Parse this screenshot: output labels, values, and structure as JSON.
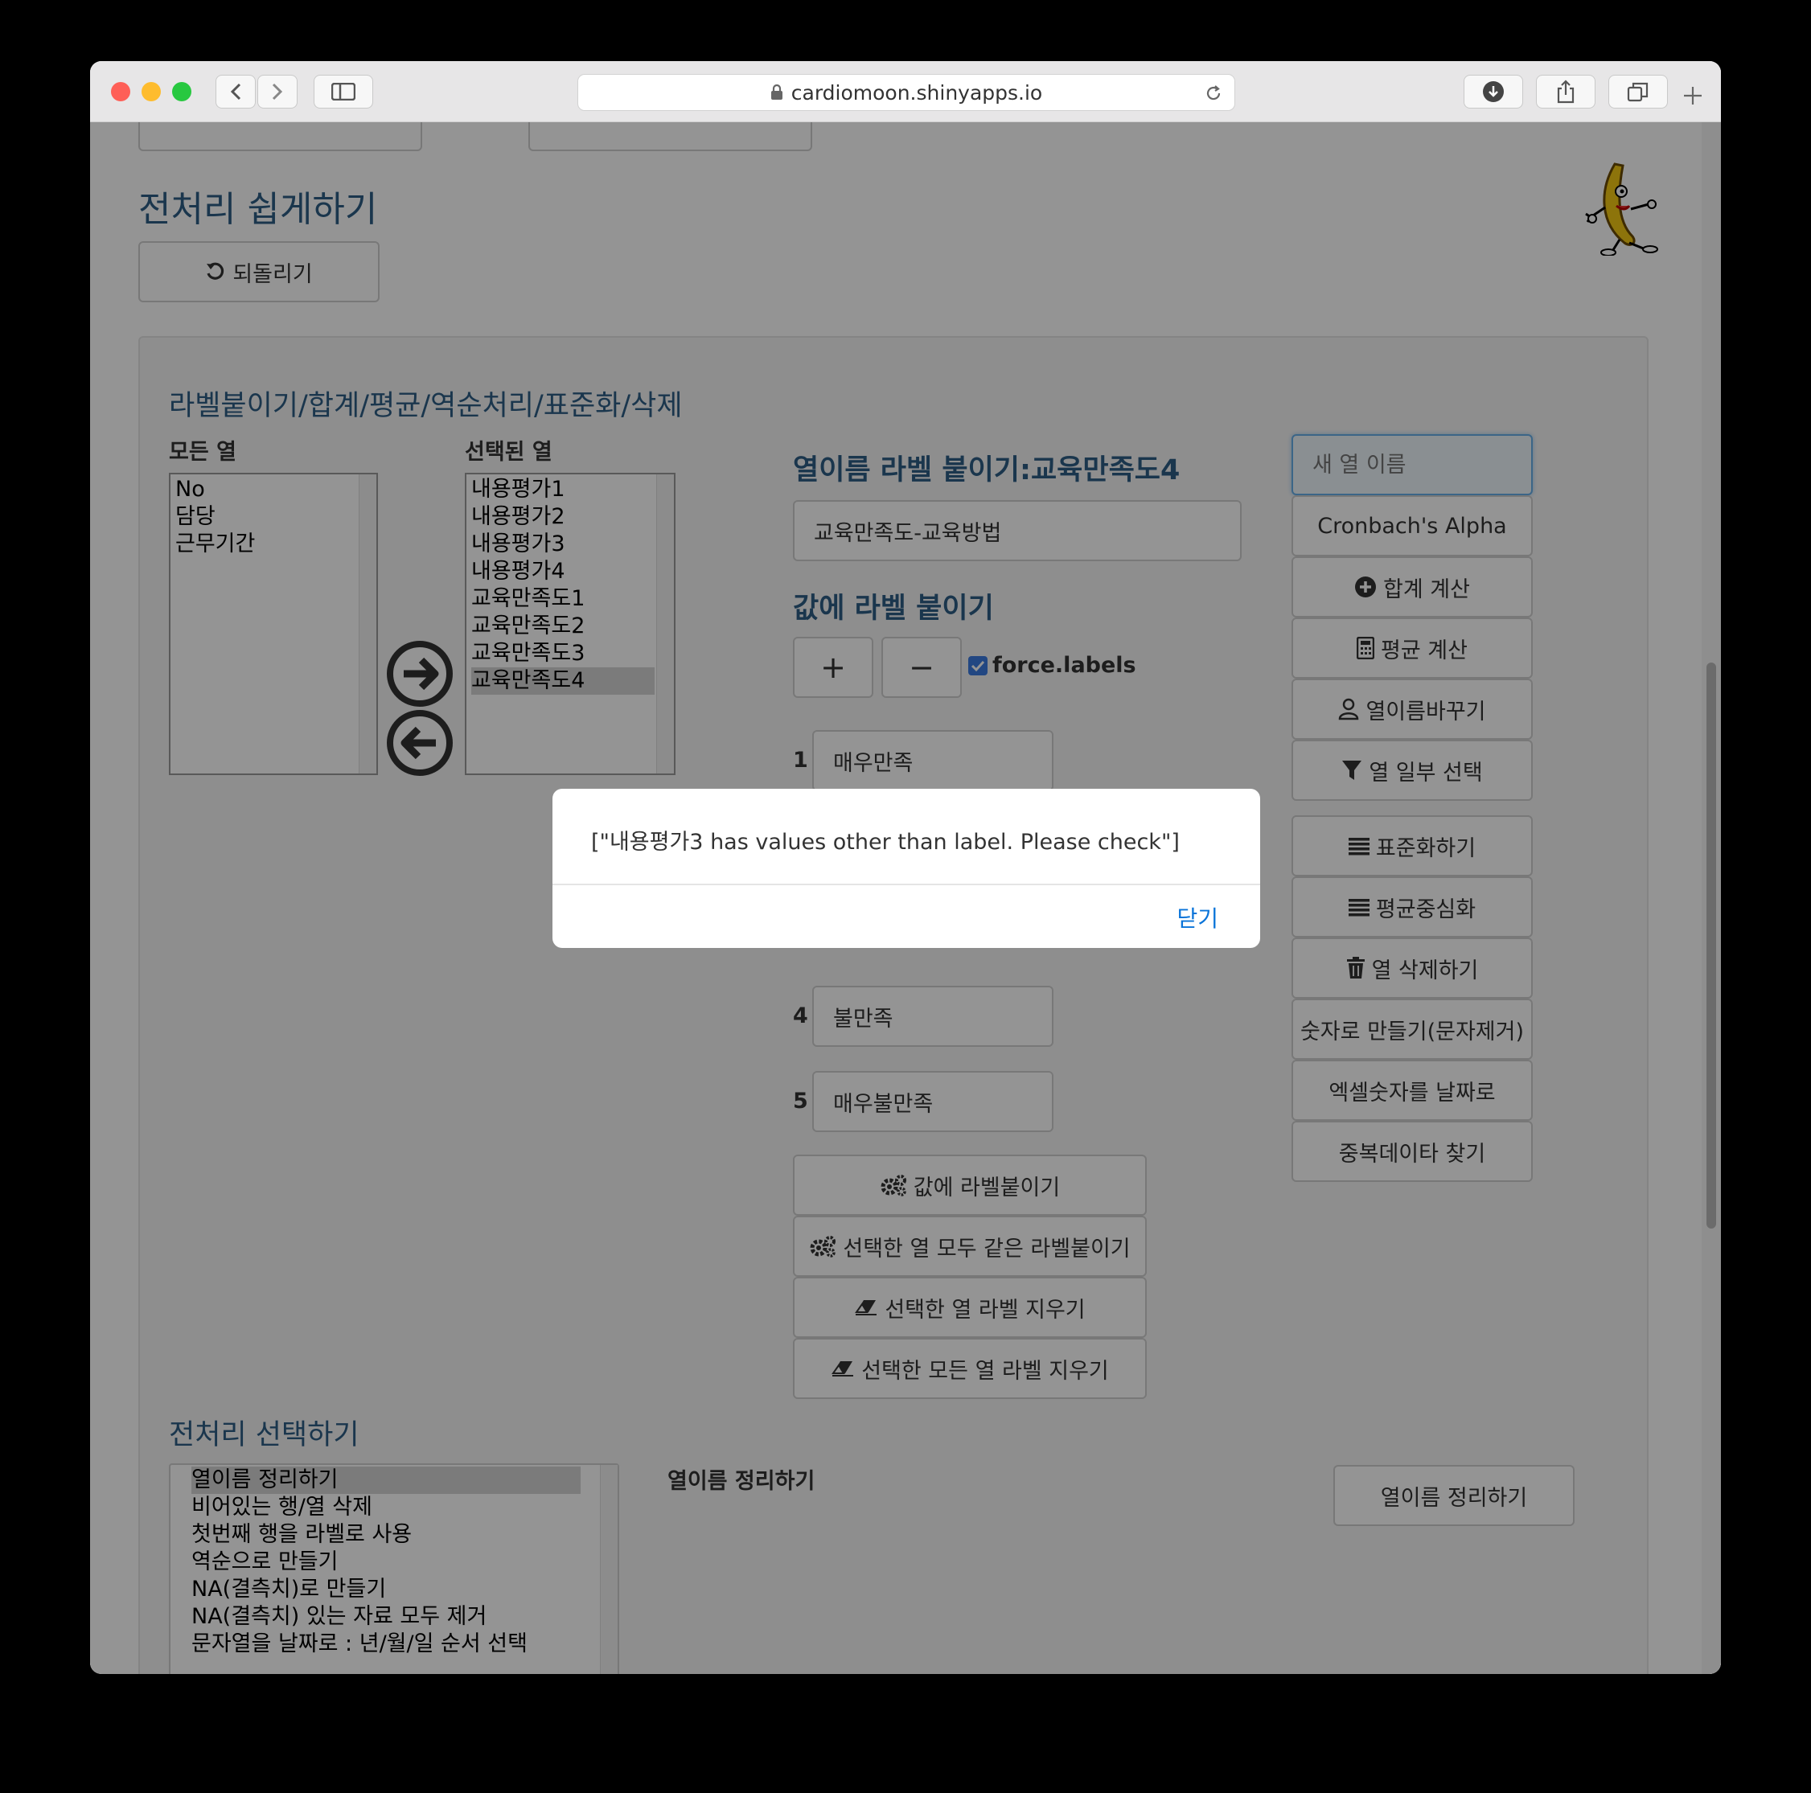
{
  "browser": {
    "url": "cardiomoon.shinyapps.io"
  },
  "page": {
    "title": "전처리 쉽게하기",
    "undo_label": "되돌리기",
    "panel_title": "라벨붙이기/합계/평균/역순처리/표준화/삭제",
    "all_columns_label": "모든 열",
    "all_columns": [
      "No",
      "담당",
      "근무기간"
    ],
    "selected_columns_label": "선택된 열",
    "selected_columns": [
      "내용평가1",
      "내용평가2",
      "내용평가3",
      "내용평가4",
      "교육만족도1",
      "교육만족도2",
      "교육만족도3",
      "교육만족도4"
    ],
    "col_label_title": "열이름 라벨 붙이기:교육만족도4",
    "col_label_value": "교육만족도-교육방법",
    "value_label_title": "값에 라벨 붙이기",
    "plus": "+",
    "minus": "−",
    "force_labels": "force.labels",
    "value_labels": [
      {
        "num": "1",
        "label": "매우만족"
      },
      {
        "num": "4",
        "label": "불만족"
      },
      {
        "num": "5",
        "label": "매우불만족"
      }
    ],
    "label_buttons": {
      "apply": "값에 라벨붙이기",
      "apply_all": "선택한 열 모두 같은 라벨붙이기",
      "clear": "선택한 열 라벨 지우기",
      "clear_all": "선택한 모든 열 라벨 지우기"
    },
    "new_col_placeholder": "새 열 이름",
    "right_buttons": {
      "cronbach": "Cronbach's Alpha",
      "sum": "합계 계산",
      "mean": "평균 계산",
      "rename": "열이름바꾸기",
      "filter": "열 일부 선택",
      "standardize": "표준화하기",
      "center": "평균중심화",
      "delete": "열 삭제하기",
      "to_numeric": "숫자로 만들기(문자제거)",
      "excel_date": "엑셀숫자를 날짜로",
      "duplicates": "중복데이타 찾기"
    },
    "preprocess_title": "전처리 선택하기",
    "preprocess_options": [
      "열이름 정리하기",
      "비어있는 행/열 삭제",
      "첫번째 행을 라벨로 사용",
      "역순으로 만들기",
      "NA(결측치)로 만들기",
      "NA(결측치) 있는 자료 모두 제거",
      "문자열을 날짜로 : 년/월/일 순서 선택"
    ],
    "preprocess_selected_label": "열이름 정리하기",
    "preprocess_button": "열이름 정리하기"
  },
  "dialog": {
    "message": "[\"내용평가3 has values other than label. Please check\"]",
    "close": "닫기"
  },
  "colors": {
    "heading_blue": "#2d5d86",
    "link_blue": "#0a74d9",
    "checkbox_blue": "#3b7be0"
  }
}
